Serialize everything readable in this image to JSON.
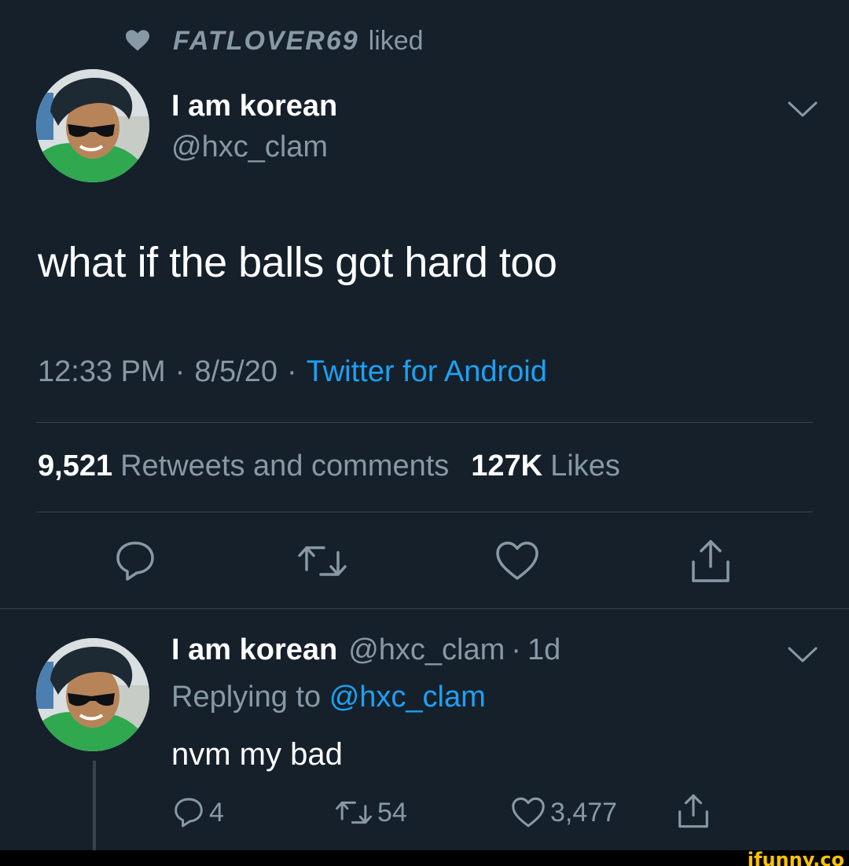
{
  "social_context": {
    "liker_name": "FATLOVER69",
    "action": "liked",
    "icon": "heart-icon"
  },
  "tweet": {
    "display_name": "I am korean",
    "handle": "@hxc_clam",
    "text": "what if the balls got hard too",
    "time": "12:33 PM",
    "separator": "·",
    "date": "8/5/20",
    "source": "Twitter for Android",
    "retweets_count": "9,521",
    "retweets_label": "Retweets and comments",
    "likes_count": "127K",
    "likes_label": "Likes",
    "actions": [
      "reply-icon",
      "retweet-icon",
      "like-icon",
      "share-icon"
    ]
  },
  "reply": {
    "display_name": "I am korean",
    "handle": "@hxc_clam",
    "separator": "·",
    "age": "1d",
    "replying_prefix": "Replying to",
    "replying_to": "@hxc_clam",
    "text": "nvm my bad",
    "reply_count": "4",
    "retweet_count": "54",
    "like_count": "3,477"
  },
  "watermark": "ifunny.co",
  "colors": {
    "background": "#15202b",
    "text": "#ffffff",
    "secondary": "#8899a6",
    "accent": "#1da1f2",
    "divider": "#38444d"
  }
}
